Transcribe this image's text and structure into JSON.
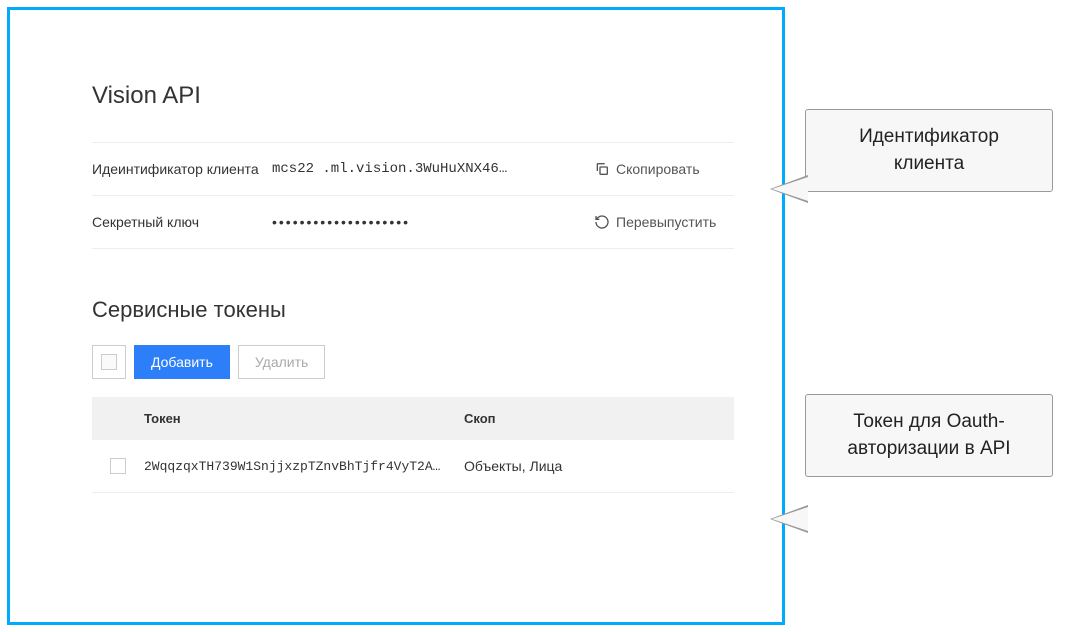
{
  "section": {
    "title": "Vision API"
  },
  "client_id": {
    "label": "Идеинтификатор клиента",
    "value": "mcs22       .ml.vision.3WuHuXNX46…",
    "action": "Скопировать"
  },
  "secret_key": {
    "label": "Секретный ключ",
    "value": "••••••••••••••••••••",
    "action": "Перевыпустить"
  },
  "tokens": {
    "title": "Сервисные токены",
    "add_label": "Добавить",
    "delete_label": "Удалить",
    "header_token": "Токен",
    "header_scope": "Скоп",
    "rows": [
      {
        "token": "2WqqzqxTH739W1SnjjxzpTZnvBhTjfr4VyT2A…",
        "scope": "Объекты, Лица"
      }
    ]
  },
  "callouts": {
    "client_id": "Идентификатор клиента",
    "oauth_token": "Токен для Oauth-авторизации в API"
  }
}
